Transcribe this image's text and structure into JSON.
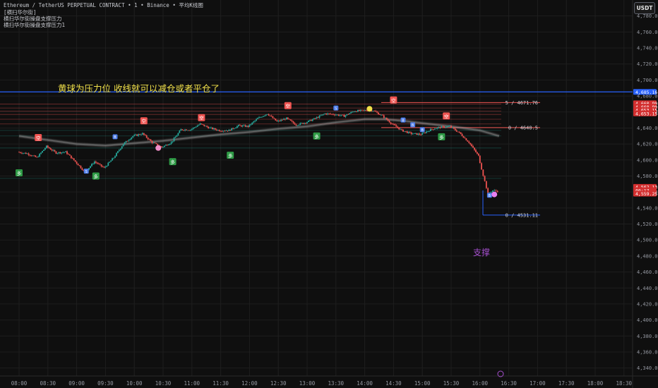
{
  "header": {
    "line1": "Ethereum / TetherUS PERPETUAL CONTRACT • 1 • Binance • 平均K线图",
    "line2": "[横扫华尔街]",
    "line3": "横扫华尔街操盘支撑压力",
    "line4": "横扫华尔街操盘支撑压力1"
  },
  "currency_button": "USDT",
  "colors": {
    "up": "#26a69a",
    "down": "#ef5350",
    "yellow": "#f0e04a",
    "purple": "#a64fcf",
    "blue": "#2962ff",
    "grid": "#1e1e1e"
  },
  "chart_data": {
    "type": "candlestick",
    "title": "",
    "annotations": [
      {
        "text": "黄球为压力位 收线就可以减仓或者平仓了",
        "color": "#f0e04a"
      },
      {
        "text": "支撑",
        "color": "#a64fcf"
      }
    ],
    "y_axis": {
      "min": 4330,
      "max": 4800,
      "ticks": [
        4780,
        4760,
        4740,
        4720,
        4700,
        4680,
        4660,
        4640,
        4620,
        4600,
        4580,
        4560,
        4540,
        4520,
        4500,
        4480,
        4460,
        4440,
        4420,
        4400,
        4380,
        4360,
        4340
      ]
    },
    "x_axis": {
      "ticks": [
        "08:00",
        "08:30",
        "09:00",
        "09:30",
        "10:00",
        "10:30",
        "11:00",
        "11:30",
        "12:00",
        "12:30",
        "13:00",
        "13:30",
        "14:00",
        "14:30",
        "15:00",
        "15:30",
        "16:00",
        "16:30",
        "17:00",
        "17:30",
        "18:00",
        "18:30"
      ]
    },
    "price_path": [
      [
        "08:00",
        4610
      ],
      [
        "08:10",
        4608
      ],
      [
        "08:20",
        4603
      ],
      [
        "08:30",
        4617
      ],
      [
        "08:40",
        4609
      ],
      [
        "08:50",
        4610
      ],
      [
        "09:00",
        4598
      ],
      [
        "09:10",
        4585
      ],
      [
        "09:20",
        4598
      ],
      [
        "09:30",
        4590
      ],
      [
        "09:40",
        4603
      ],
      [
        "09:50",
        4620
      ],
      [
        "10:00",
        4630
      ],
      [
        "10:10",
        4633
      ],
      [
        "10:20",
        4622
      ],
      [
        "10:30",
        4616
      ],
      [
        "10:40",
        4622
      ],
      [
        "10:50",
        4638
      ],
      [
        "11:00",
        4638
      ],
      [
        "11:10",
        4645
      ],
      [
        "11:20",
        4640
      ],
      [
        "11:30",
        4637
      ],
      [
        "11:40",
        4637
      ],
      [
        "11:50",
        4643
      ],
      [
        "12:00",
        4642
      ],
      [
        "12:10",
        4652
      ],
      [
        "12:20",
        4658
      ],
      [
        "12:30",
        4648
      ],
      [
        "12:40",
        4652
      ],
      [
        "12:50",
        4644
      ],
      [
        "13:00",
        4647
      ],
      [
        "13:10",
        4652
      ],
      [
        "13:20",
        4658
      ],
      [
        "13:30",
        4657
      ],
      [
        "13:40",
        4655
      ],
      [
        "13:50",
        4661
      ],
      [
        "14:00",
        4662
      ],
      [
        "14:10",
        4662
      ],
      [
        "14:20",
        4655
      ],
      [
        "14:30",
        4645
      ],
      [
        "14:40",
        4637
      ],
      [
        "14:50",
        4633
      ],
      [
        "15:00",
        4632
      ],
      [
        "15:10",
        4638
      ],
      [
        "15:20",
        4641
      ],
      [
        "15:30",
        4642
      ],
      [
        "15:40",
        4634
      ],
      [
        "15:50",
        4622
      ],
      [
        "16:00",
        4605
      ],
      [
        "16:05",
        4581
      ],
      [
        "16:10",
        4558
      ],
      [
        "16:15",
        4562
      ],
      [
        "16:20",
        4561
      ]
    ],
    "moving_average": [
      [
        "08:00",
        4630
      ],
      [
        "09:00",
        4620
      ],
      [
        "09:30",
        4618
      ],
      [
        "10:00",
        4621
      ],
      [
        "10:30",
        4624
      ],
      [
        "11:00",
        4628
      ],
      [
        "11:30",
        4632
      ],
      [
        "12:00",
        4635
      ],
      [
        "12:30",
        4639
      ],
      [
        "13:00",
        4642
      ],
      [
        "13:30",
        4647
      ],
      [
        "14:00",
        4651
      ],
      [
        "14:20",
        4651
      ],
      [
        "14:40",
        4649
      ],
      [
        "15:00",
        4646
      ],
      [
        "15:30",
        4642
      ],
      [
        "16:00",
        4637
      ],
      [
        "16:20",
        4630
      ]
    ],
    "horizontal_levels": [
      {
        "label": "5 / 4671.76",
        "price": 4671.76,
        "color": "#ef5350"
      },
      {
        "label": "0 / 4640.5",
        "price": 4640.5,
        "color": "#ef5350"
      },
      {
        "label": "0 / 4531.11",
        "price": 4531.11,
        "color": "#2962ff"
      }
    ],
    "price_tags": [
      {
        "text": "4,685.16",
        "price": 4685.16,
        "color": "#2962ff"
      },
      {
        "text": "4,660.90",
        "price": 4670.9,
        "color": "#d32f2f"
      },
      {
        "text": "4,660.90",
        "price": 4666.7,
        "color": "#d32f2f"
      },
      {
        "text": "4,653.15",
        "price": 4662.5,
        "color": "#d32f2f"
      },
      {
        "text": "4,653.15",
        "price": 4658.3,
        "color": "#d32f2f"
      },
      {
        "text": "4,562.13",
        "price": 4566.4,
        "color": "#d32f2f"
      },
      {
        "text": "00:17",
        "price": 4562.2,
        "color": "#d32f2f"
      },
      {
        "text": "4,559.25",
        "price": 4558.0,
        "color": "#d32f2f"
      }
    ],
    "signals": [
      {
        "t": "08:20",
        "p": 4628,
        "kind": "sell",
        "label": "空"
      },
      {
        "t": "08:00",
        "p": 4584,
        "kind": "buy",
        "label": "多"
      },
      {
        "t": "09:20",
        "p": 4580,
        "kind": "buy",
        "label": "多"
      },
      {
        "t": "09:10",
        "p": 4586,
        "kind": "blue",
        "label": "S"
      },
      {
        "t": "09:40",
        "p": 4629,
        "kind": "blue",
        "label": "B"
      },
      {
        "t": "10:10",
        "p": 4649,
        "kind": "sell",
        "label": "空"
      },
      {
        "t": "10:40",
        "p": 4598,
        "kind": "buy",
        "label": "多"
      },
      {
        "t": "11:10",
        "p": 4653,
        "kind": "sell",
        "label": "空"
      },
      {
        "t": "11:40",
        "p": 4606,
        "kind": "buy",
        "label": "多"
      },
      {
        "t": "12:40",
        "p": 4668,
        "kind": "sell",
        "label": "空"
      },
      {
        "t": "13:10",
        "p": 4630,
        "kind": "buy",
        "label": "多"
      },
      {
        "t": "13:30",
        "p": 4665,
        "kind": "blue",
        "label": "S"
      },
      {
        "t": "14:30",
        "p": 4675,
        "kind": "sell",
        "label": "空"
      },
      {
        "t": "14:40",
        "p": 4650,
        "kind": "blue",
        "label": "B"
      },
      {
        "t": "14:50",
        "p": 4644,
        "kind": "blue",
        "label": "B"
      },
      {
        "t": "15:00",
        "p": 4638,
        "kind": "blue",
        "label": "B"
      },
      {
        "t": "15:20",
        "p": 4629,
        "kind": "buy",
        "label": "多"
      },
      {
        "t": "15:25",
        "p": 4655,
        "kind": "sell",
        "label": "空"
      },
      {
        "t": "16:10",
        "p": 4556,
        "kind": "blue",
        "label": "B"
      }
    ],
    "balls": [
      {
        "t": "10:25",
        "p": 4615,
        "color": "#f08ec9"
      },
      {
        "t": "14:05",
        "p": 4664,
        "color": "#f0e04a"
      },
      {
        "t": "16:15",
        "p": 4557,
        "color": "#e880f0"
      }
    ]
  }
}
